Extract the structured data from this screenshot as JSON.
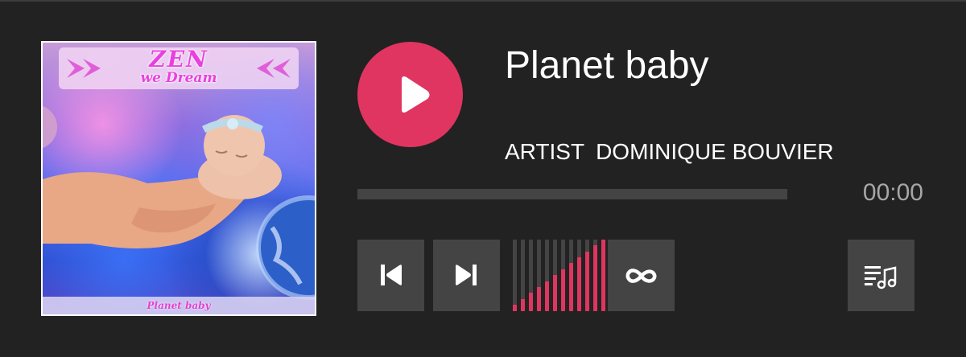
{
  "player": {
    "track_title": "Planet baby",
    "artist_label": "ARTIST",
    "artist_name": "DOMINIQUE BOUVIER",
    "time": "00:00",
    "progress": 0,
    "volume_level": 1.0,
    "accent_color": "#e03560"
  },
  "cover": {
    "title": "ZEN",
    "subtitle": "we Dream",
    "caption": "Planet baby"
  },
  "controls": {
    "play_icon": "play-icon",
    "prev_icon": "skip-previous-icon",
    "next_icon": "skip-next-icon",
    "loop_icon": "loop-icon",
    "playlist_icon": "playlist-music-icon"
  }
}
